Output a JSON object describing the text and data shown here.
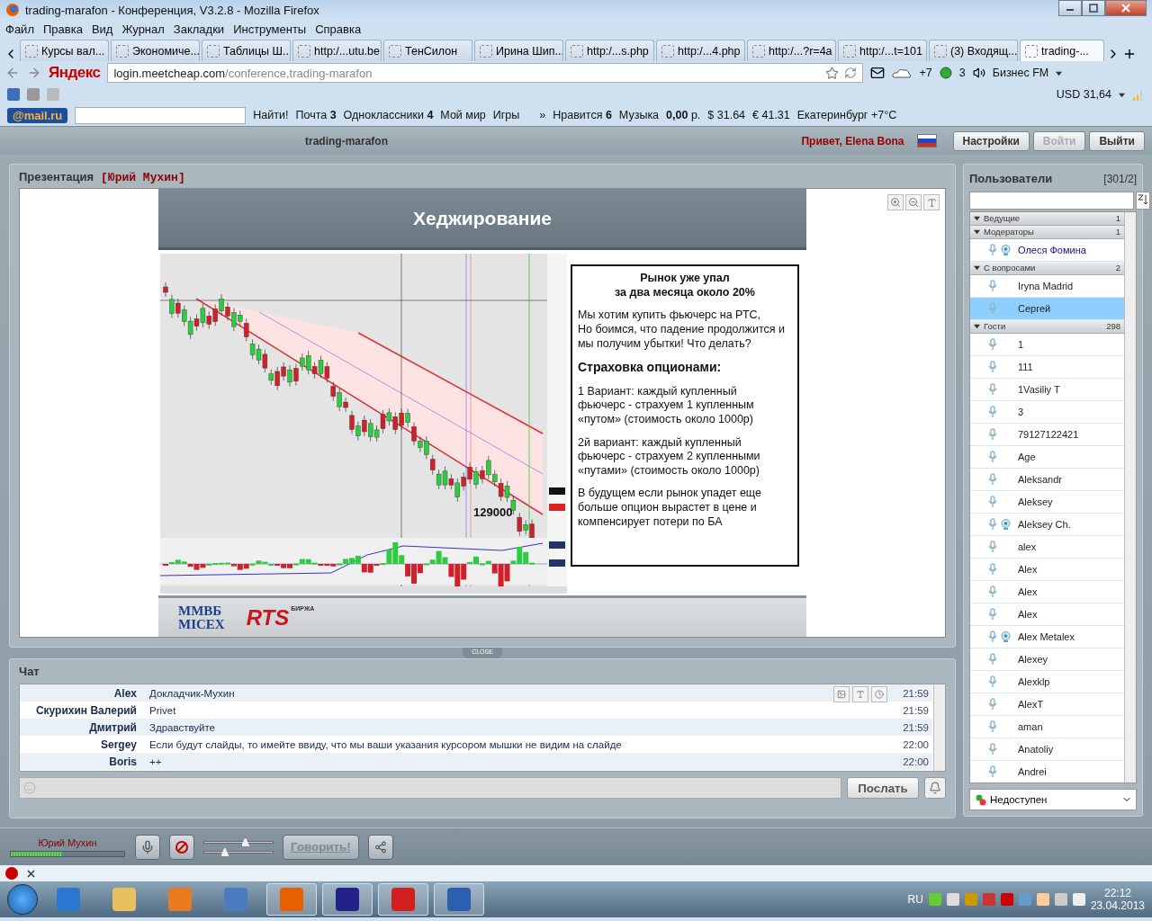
{
  "window": {
    "title": "trading-marafon - Конференция, V3.2.8 - Mozilla Firefox"
  },
  "menu": [
    "Файл",
    "Правка",
    "Вид",
    "Журнал",
    "Закладки",
    "Инструменты",
    "Справка"
  ],
  "tabs": [
    {
      "label": "Курсы вал...",
      "selected": false
    },
    {
      "label": "Экономиче...",
      "selected": false
    },
    {
      "label": "Таблицы Ш...",
      "selected": false
    },
    {
      "label": "http:/...utu.be",
      "selected": false
    },
    {
      "label": "ТенСилон",
      "selected": false
    },
    {
      "label": "Ирина Шип...",
      "selected": false
    },
    {
      "label": "http:/...s.php",
      "selected": false
    },
    {
      "label": "http:/...4.php",
      "selected": false
    },
    {
      "label": "http:/...?r=4a",
      "selected": false
    },
    {
      "label": "http:/...t=101",
      "selected": false
    },
    {
      "label": "(3) Входящ...",
      "selected": false
    },
    {
      "label": "trading-...",
      "selected": true
    }
  ],
  "navbar": {
    "logo": "Яндекс",
    "url_host": "login.meetcheap.com",
    "url_path": "/conference,trading-marafon",
    "weather": "+7",
    "notifications": "3",
    "radio": "Бизнес FM",
    "currency": "USD 31,64"
  },
  "mail_toolbar": {
    "logo": "@mail.ru",
    "search_button": "Найти!",
    "items": [
      "Почта **3**",
      "Одноклассники **4**",
      "Мой мир",
      "Игры"
    ],
    "overflow": "»",
    "right_items": [
      "Нравится **6**",
      "Музыка",
      "**0,00** р.",
      "$ 31.64",
      "€ 41.31",
      "Екатеринбург +7°C"
    ]
  },
  "app_header": {
    "title": "trading-marafon",
    "greeting": "Привет, Elena Bona",
    "buttons": [
      {
        "label": "Настройки",
        "disabled": false
      },
      {
        "label": "Войти",
        "disabled": true
      },
      {
        "label": "Выйти",
        "disabled": false
      }
    ]
  },
  "presentation": {
    "title": "Презентация",
    "presenter": "[Юрий Мухин]",
    "slide": {
      "title": "Хеджирование",
      "chart_callout": "129000",
      "paragraphs": [
        {
          "kind": "heading",
          "text": "Рынок уже упал\nза два месяца около 20%"
        },
        {
          "kind": "body",
          "text": "Мы хотим купить фьючерс на РТС,\nНо боимся, что падение продолжится и\nмы получим убытки!  Что делать?"
        },
        {
          "kind": "subheading",
          "text": "Страховка опционами:"
        },
        {
          "kind": "body",
          "text": "1 Вариант:  каждый купленный\nфьючерс - страхуем 1 купленным\n«путом»  (стоимость около 1000р)"
        },
        {
          "kind": "body",
          "text": "2й вариант:  каждый купленный\nфьючерс - страхуем 2 купленными\n«путами» (стоимость около 1000р)"
        },
        {
          "kind": "body",
          "text": "В будущем если рынок упадет еще\nбольше опцион вырастет в цене и\nкомпенсирует потери по БА"
        }
      ],
      "logos": {
        "micex_top": "ММВБ",
        "micex_bottom": "MICEX",
        "rts": "RTS",
        "rts_sub": "БИРЖА"
      }
    }
  },
  "collapse_handle": "CLOSE",
  "chat": {
    "title": "Чат",
    "messages": [
      {
        "author": "Alex",
        "text": "Докладчик-Мухин",
        "time": "21:59"
      },
      {
        "author": "Скурихин Валерий",
        "text": "Privet",
        "time": "21:59"
      },
      {
        "author": "Дмитрий",
        "text": "Здравствуйте",
        "time": "21:59"
      },
      {
        "author": "Sergey",
        "text": "Если будут слайды, то имейте ввиду, что мы ваши указания курсором мышки не видим на слайде",
        "time": "22:00"
      },
      {
        "author": "Boris",
        "text": "++",
        "time": "22:00"
      }
    ],
    "send_button": "Послать"
  },
  "users": {
    "title": "Пользователи",
    "count": "[301/2]",
    "groups": [
      {
        "name": "Ведущие",
        "count": "1",
        "expanded": true
      },
      {
        "name": "Модераторы",
        "count": "1",
        "expanded": true,
        "users": [
          {
            "name": "Олеся Фомина",
            "webcam": true,
            "selected": false
          }
        ]
      },
      {
        "name": "С вопросами",
        "count": "2",
        "expanded": true,
        "users": [
          {
            "name": "Iryna Madrid",
            "webcam": false,
            "selected": false
          },
          {
            "name": "Сергей",
            "webcam": false,
            "selected": true
          }
        ]
      },
      {
        "name": "Гости",
        "count": "298",
        "expanded": true,
        "users": [
          {
            "name": "1",
            "webcam": false,
            "selected": false
          },
          {
            "name": "111",
            "webcam": false,
            "selected": false
          },
          {
            "name": "1Vasiliy T",
            "webcam": false,
            "selected": false
          },
          {
            "name": "3",
            "webcam": false,
            "selected": false
          },
          {
            "name": "79127122421",
            "webcam": false,
            "selected": false
          },
          {
            "name": "Age",
            "webcam": false,
            "selected": false
          },
          {
            "name": "Aleksandr",
            "webcam": false,
            "selected": false
          },
          {
            "name": "Aleksey",
            "webcam": false,
            "selected": false
          },
          {
            "name": "Aleksey Ch.",
            "webcam": true,
            "selected": false
          },
          {
            "name": "alex",
            "webcam": false,
            "selected": false
          },
          {
            "name": "Alex",
            "webcam": false,
            "selected": false
          },
          {
            "name": "Alex",
            "webcam": false,
            "selected": false
          },
          {
            "name": "Alex",
            "webcam": false,
            "selected": false
          },
          {
            "name": "Alex Metalex",
            "webcam": true,
            "selected": false
          },
          {
            "name": "Alexey",
            "webcam": false,
            "selected": false
          },
          {
            "name": "Alexklp",
            "webcam": false,
            "selected": false
          },
          {
            "name": "AlexT",
            "webcam": false,
            "selected": false
          },
          {
            "name": "aman",
            "webcam": false,
            "selected": false
          },
          {
            "name": "Anatoliy",
            "webcam": false,
            "selected": false
          },
          {
            "name": "Andrei",
            "webcam": false,
            "selected": false
          }
        ]
      }
    ],
    "status": "Недоступен"
  },
  "voice_bar": {
    "speaker": "Юрий Мухин",
    "mic_meter": {
      "level": 0.45
    },
    "volume": {
      "level": 0.6
    },
    "mic_volume": {
      "level": 0.3
    },
    "talk_button": {
      "label": "Говорить!",
      "disabled": true
    }
  },
  "taskbar": {
    "language": "RU",
    "time": "22:12",
    "date": "23.04.2013"
  }
}
